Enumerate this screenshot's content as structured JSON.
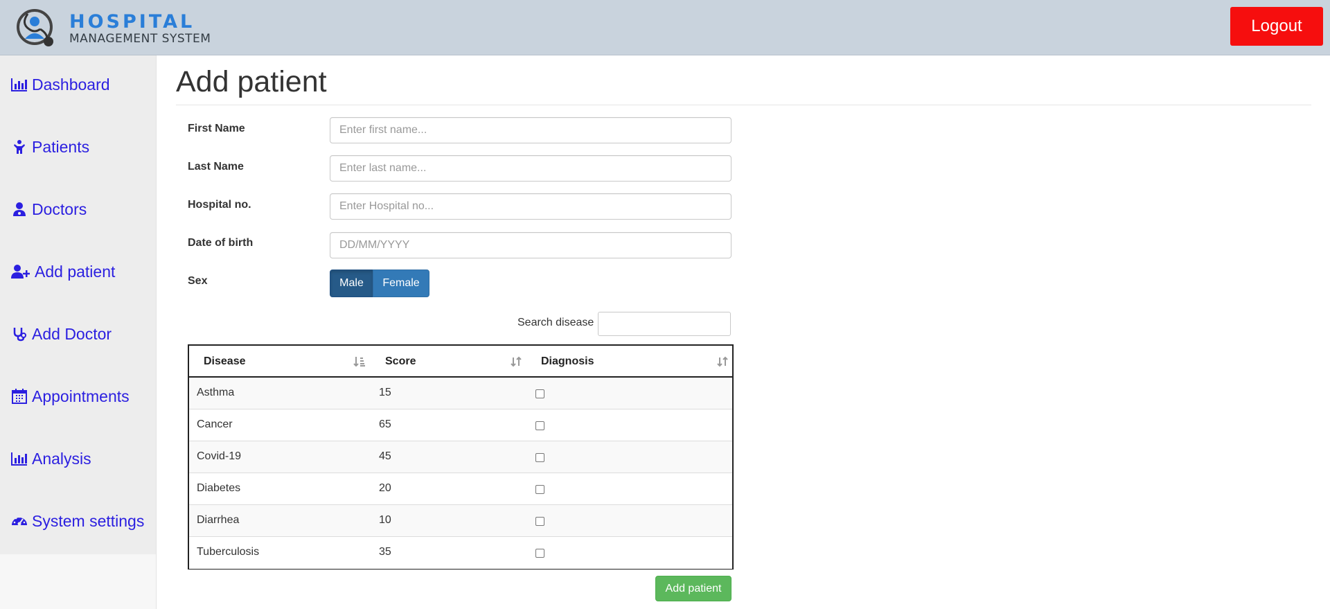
{
  "header": {
    "logo_title": "HOSPITAL",
    "logo_subtitle": "MANAGEMENT SYSTEM",
    "logout_label": "Logout",
    "colors": {
      "bar": "#c9d3dd",
      "logout": "#f60e0e",
      "brand": "#2a7ed8"
    }
  },
  "sidebar": {
    "link_color": "#2b1fe0",
    "items": [
      {
        "label": "Dashboard",
        "icon": "bar-chart-icon"
      },
      {
        "label": "Patients",
        "icon": "child-icon"
      },
      {
        "label": "Doctors",
        "icon": "user-doctor-icon"
      },
      {
        "label": "Add patient",
        "icon": "user-plus-icon"
      },
      {
        "label": "Add Doctor",
        "icon": "stethoscope-icon"
      },
      {
        "label": "Appointments",
        "icon": "calendar-icon"
      },
      {
        "label": "Analysis",
        "icon": "bar-chart-icon"
      },
      {
        "label": "System settings",
        "icon": "dashboard-gauge-icon"
      }
    ]
  },
  "page": {
    "title": "Add patient"
  },
  "form": {
    "first_name": {
      "label": "First Name",
      "placeholder": "Enter first name...",
      "value": ""
    },
    "last_name": {
      "label": "Last Name",
      "placeholder": "Enter last name...",
      "value": ""
    },
    "hospital_no": {
      "label": "Hospital no.",
      "placeholder": "Enter Hospital no...",
      "value": ""
    },
    "dob": {
      "label": "Date of birth",
      "placeholder": "DD/MM/YYYY",
      "value": ""
    },
    "sex": {
      "label": "Sex",
      "options": [
        "Male",
        "Female"
      ],
      "selected": "Male"
    }
  },
  "disease_table": {
    "search_label": "Search disease",
    "search_value": "",
    "columns": [
      "Disease",
      "Score",
      "Diagnosis"
    ],
    "rows": [
      {
        "disease": "Asthma",
        "score": "15",
        "diagnosis": false
      },
      {
        "disease": "Cancer",
        "score": "65",
        "diagnosis": false
      },
      {
        "disease": "Covid-19",
        "score": "45",
        "diagnosis": false
      },
      {
        "disease": "Diabetes",
        "score": "20",
        "diagnosis": false
      },
      {
        "disease": "Diarrhea",
        "score": "10",
        "diagnosis": false
      },
      {
        "disease": "Tuberculosis",
        "score": "35",
        "diagnosis": false
      }
    ]
  },
  "submit_label": "Add patient"
}
